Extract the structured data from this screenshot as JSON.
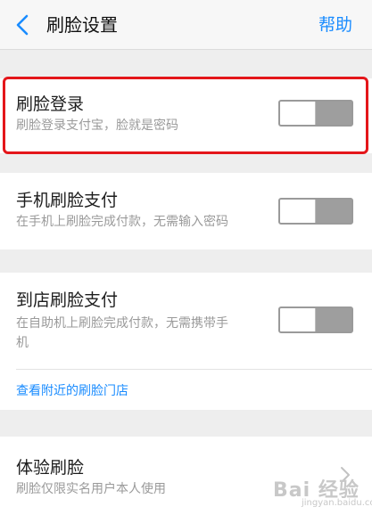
{
  "nav": {
    "title": "刷脸设置",
    "help": "帮助",
    "back_icon": "chevron-left-icon"
  },
  "settings": [
    {
      "title": "刷脸登录",
      "subtitle": "刷脸登录支付宝，脸就是密码",
      "toggle_on": false
    },
    {
      "title": "手机刷脸支付",
      "subtitle": "在手机上刷脸完成付款，无需输入密码",
      "toggle_on": false
    },
    {
      "title": "到店刷脸支付",
      "subtitle_line1": "在自助机上刷脸完成付款，无需携带手",
      "subtitle_line2": "机",
      "toggle_on": false,
      "link": "查看附近的刷脸门店"
    },
    {
      "title": "体验刷脸",
      "subtitle": "刷脸仅限实名用户本人使用"
    }
  ],
  "watermark": {
    "text": "Bai 经验",
    "sub": "jingyan.baidu.com"
  },
  "colors": {
    "accent": "#1a8cff",
    "highlight": "#e4161a",
    "toggle_off": "#9e9e9e"
  }
}
